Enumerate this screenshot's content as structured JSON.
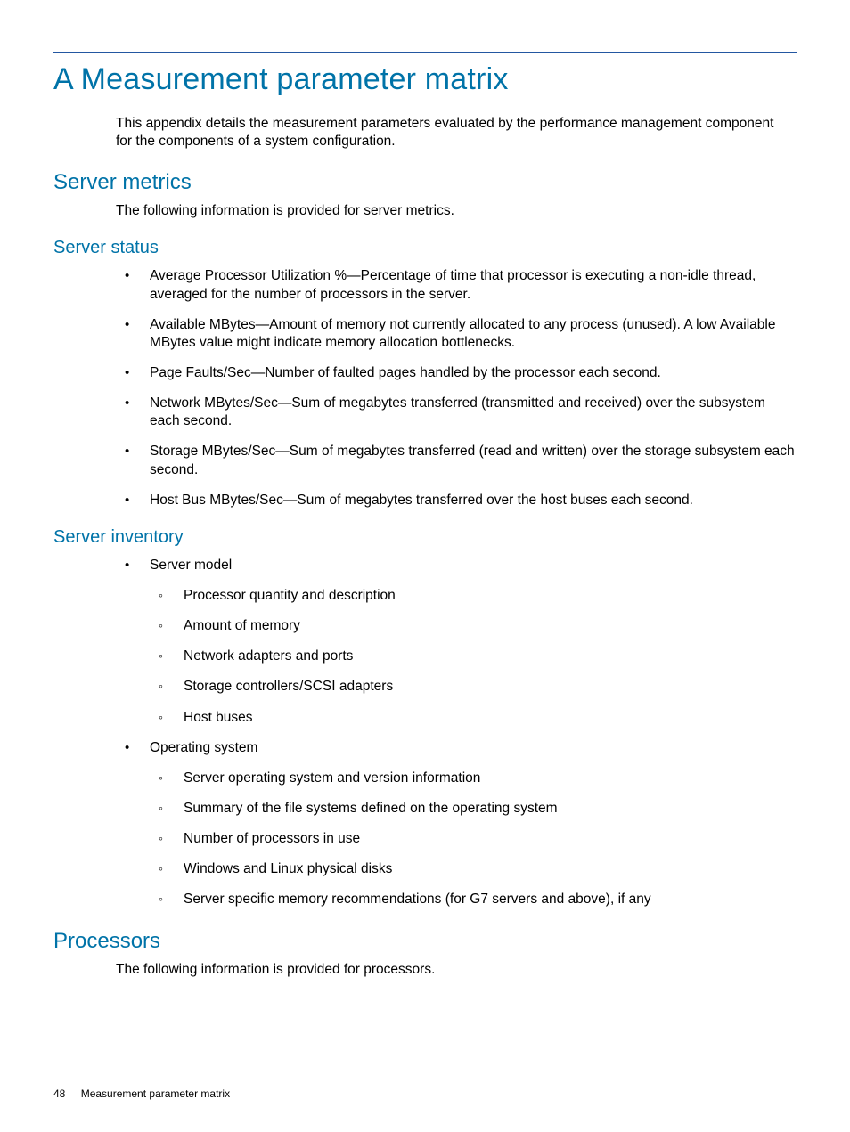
{
  "title": "A Measurement parameter matrix",
  "intro": "This appendix details the measurement parameters evaluated by the performance management component for the components of a system configuration.",
  "server_metrics": {
    "heading": "Server metrics",
    "intro": "The following information is provided for server metrics."
  },
  "server_status": {
    "heading": "Server status",
    "items": [
      "Average Processor Utilization %—Percentage of time that processor is executing a non-idle thread, averaged for the number of processors in the server.",
      "Available MBytes—Amount of memory not currently allocated to any process (unused). A low Available MBytes value might indicate memory allocation bottlenecks.",
      "Page Faults/Sec—Number of faulted pages handled by the processor each second.",
      "Network MBytes/Sec—Sum of megabytes transferred (transmitted and received) over the subsystem each second.",
      "Storage MBytes/Sec—Sum of megabytes transferred (read and written) over the storage subsystem each second.",
      "Host Bus MBytes/Sec—Sum of megabytes transferred over the host buses each second."
    ]
  },
  "server_inventory": {
    "heading": "Server inventory",
    "items": [
      {
        "label": "Server model",
        "sub": [
          "Processor quantity and description",
          "Amount of memory",
          "Network adapters and ports",
          "Storage controllers/SCSI adapters",
          "Host buses"
        ]
      },
      {
        "label": "Operating system",
        "sub": [
          "Server operating system and version information",
          "Summary of the file systems defined on the operating system",
          "Number of processors in use",
          "Windows and Linux physical disks",
          "Server specific memory recommendations (for G7 servers and above), if any"
        ]
      }
    ]
  },
  "processors": {
    "heading": "Processors",
    "intro": "The following information is provided for processors."
  },
  "footer": {
    "page": "48",
    "label": "Measurement parameter matrix"
  }
}
